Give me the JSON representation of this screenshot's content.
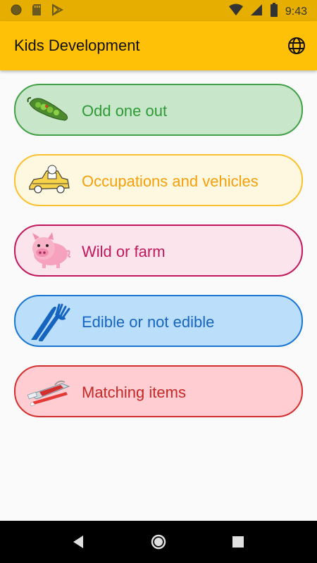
{
  "status_bar": {
    "time": "9:43",
    "bg_color": "#e6ae00",
    "left_icons": [
      "circle-notification-icon",
      "sd-card-icon",
      "play-store-icon"
    ],
    "right_icons": [
      "wifi-icon",
      "signal-icon",
      "battery-icon"
    ]
  },
  "app_bar": {
    "title": "Kids Development",
    "bg_color": "#ffc107",
    "action_icon": "globe-icon"
  },
  "menu": {
    "items": [
      {
        "label": "Odd one out",
        "icon": "pea-pod-icon",
        "text_color": "#2e9a36",
        "bg": "#c8e6c9",
        "border": "#43a047"
      },
      {
        "label": "Occupations and vehicles",
        "icon": "taxi-icon",
        "text_color": "#f5a00b",
        "bg": "#fff8e1",
        "border": "#fbc02d"
      },
      {
        "label": "Wild or farm",
        "icon": "pig-icon",
        "text_color": "#c2185b",
        "bg": "#fce4ec",
        "border": "#c2185b"
      },
      {
        "label": "Edible or not edible",
        "icon": "fork-knife-icon",
        "text_color": "#1565c0",
        "bg": "#bbdefb",
        "border": "#1976d2"
      },
      {
        "label": "Matching items",
        "icon": "toothbrush-icon",
        "text_color": "#c62828",
        "bg": "#ffcdd2",
        "border": "#d32f2f"
      }
    ]
  },
  "nav_bar": {
    "buttons": [
      "back-icon",
      "home-icon",
      "recents-icon"
    ]
  }
}
